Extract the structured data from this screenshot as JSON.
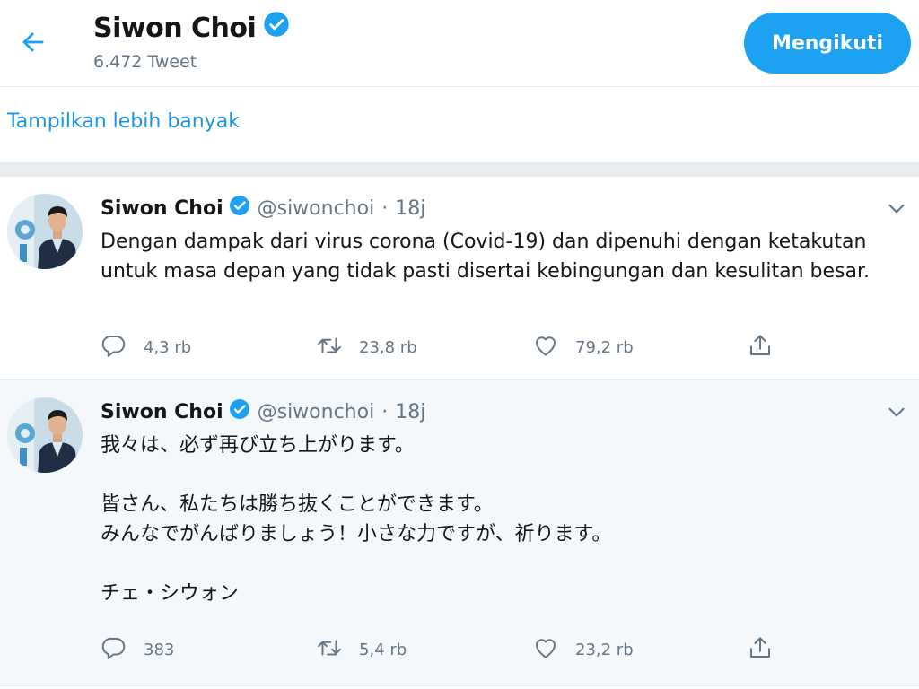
{
  "header": {
    "name": "Siwon Choi",
    "tweet_count": "6.472 Tweet",
    "follow_label": "Mengikuti"
  },
  "show_more": "Tampilkan lebih banyak",
  "tweets": [
    {
      "name": "Siwon Choi",
      "handle": "@siwonchoi",
      "dot": "·",
      "time": "18j",
      "text": "Dengan dampak dari virus corona (Covid-19) dan dipenuhi dengan ketakutan untuk masa depan yang tidak pasti disertai kebingungan dan kesulitan besar.",
      "replies": "4,3 rb",
      "retweets": "23,8 rb",
      "likes": "79,2 rb"
    },
    {
      "name": "Siwon Choi",
      "handle": "@siwonchoi",
      "dot": "·",
      "time": "18j",
      "text": "我々は、必ず再び立ち上がります。\n\n皆さん、私たちは勝ち抜くことができます。\nみんなでがんばりましょう！小さな力ですが、祈ります。\n\nチェ・シウォン",
      "replies": "383",
      "retweets": "5,4 rb",
      "likes": "23,2 rb"
    }
  ],
  "icons": {
    "back": "arrow-left-icon",
    "verified": "verified-badge-icon",
    "caret": "chevron-down-icon",
    "reply": "reply-icon",
    "retweet": "retweet-icon",
    "like": "heart-icon",
    "share": "share-icon"
  },
  "colors": {
    "accent": "#1da1f2",
    "link": "#1b95e0",
    "muted": "#657786",
    "divider": "#e6ecf0"
  }
}
